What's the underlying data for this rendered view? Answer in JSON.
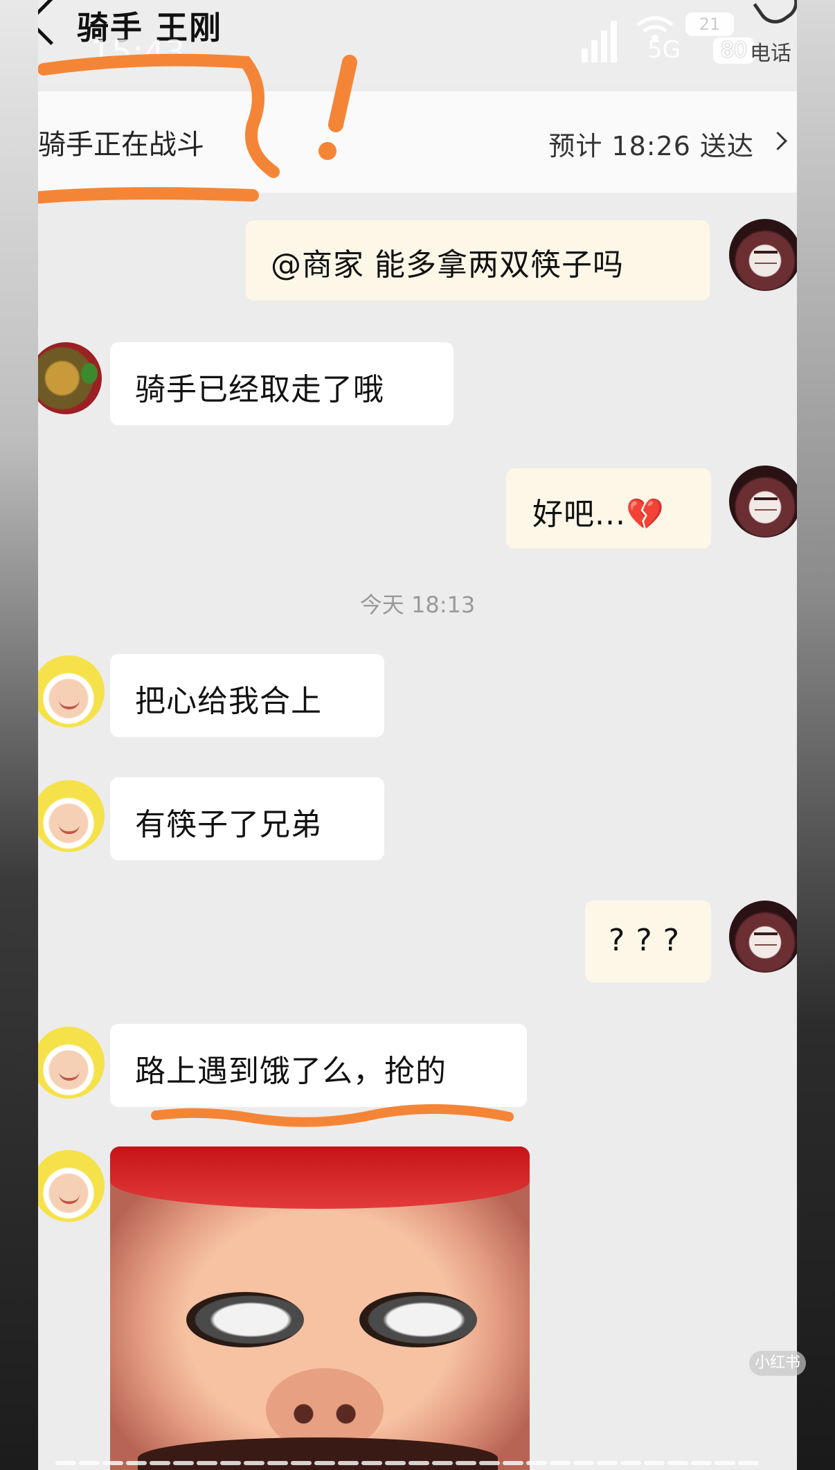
{
  "nav": {
    "title": "骑手 王刚",
    "time": "15:43",
    "network": "5G",
    "battery_top": "21",
    "battery_pct": "80",
    "call_label": "电话"
  },
  "rider_bar": {
    "status": "骑手正在战斗",
    "eta": "预计 18:26 送达"
  },
  "messages": [
    {
      "side": "me",
      "text": "@商家 能多拿两双筷子吗"
    },
    {
      "side": "shop",
      "text": "骑手已经取走了哦"
    },
    {
      "side": "me",
      "text": "好吧...💔"
    },
    {
      "side": "rider",
      "text": "把心给我合上"
    },
    {
      "side": "rider",
      "text": "有筷子了兄弟"
    },
    {
      "side": "me",
      "text": "? ? ?"
    },
    {
      "side": "rider",
      "text": "路上遇到饿了么，抢的"
    }
  ],
  "timestamp": "今天 18:13",
  "watermark": "小红书",
  "colors": {
    "annotation": "#f58536",
    "me_bubble": "#fdf7e8",
    "them_bubble": "#ffffff"
  }
}
